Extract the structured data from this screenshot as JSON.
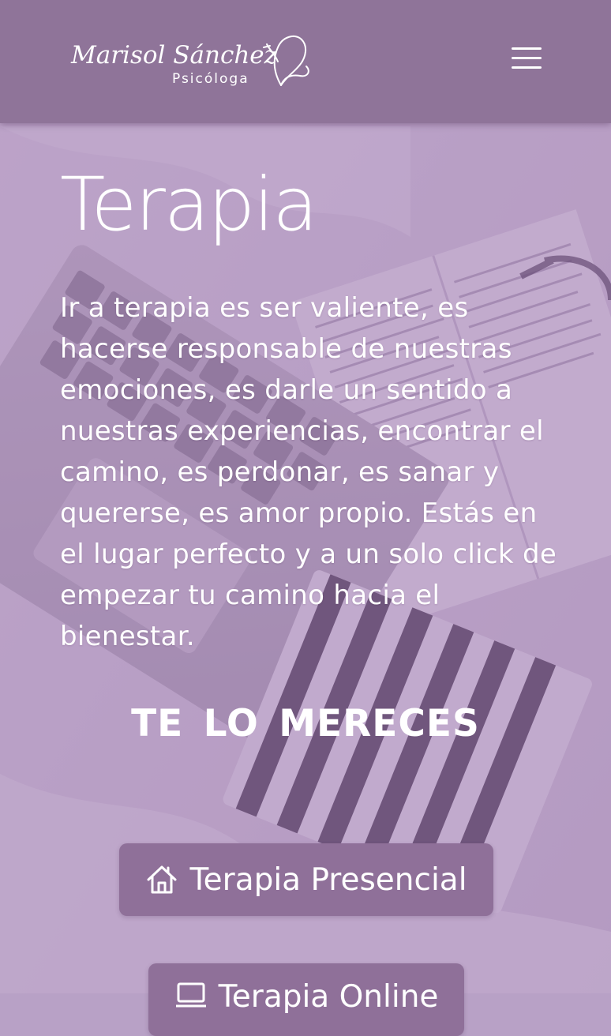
{
  "header": {
    "logo": {
      "name": "Marisol Sánchez",
      "subtitle": "Psicóloga"
    },
    "menu_icon": "hamburger-menu-icon"
  },
  "hero": {
    "title": "Terapia",
    "intro": "Ir a terapia es ser valiente, es hacerse responsable de nuestras emociones, es darle un sentido a nuestras experiencias, encontrar el camino, es perdonar, es sanar y quererse, es amor propio. Estás en el lugar perfecto y a un solo click de empezar tu camino hacia el bienestar.",
    "tagline": "TE  LO  MERECES"
  },
  "buttons": {
    "presencial": {
      "label": "Terapia Presencial",
      "icon": "home-icon"
    },
    "online": {
      "label": "Terapia Online",
      "icon": "laptop-icon"
    }
  },
  "colors": {
    "header_bg": "#8f7499",
    "button_bg": "#8f7099",
    "overlay": "#9870ac",
    "text": "#ffffff"
  }
}
